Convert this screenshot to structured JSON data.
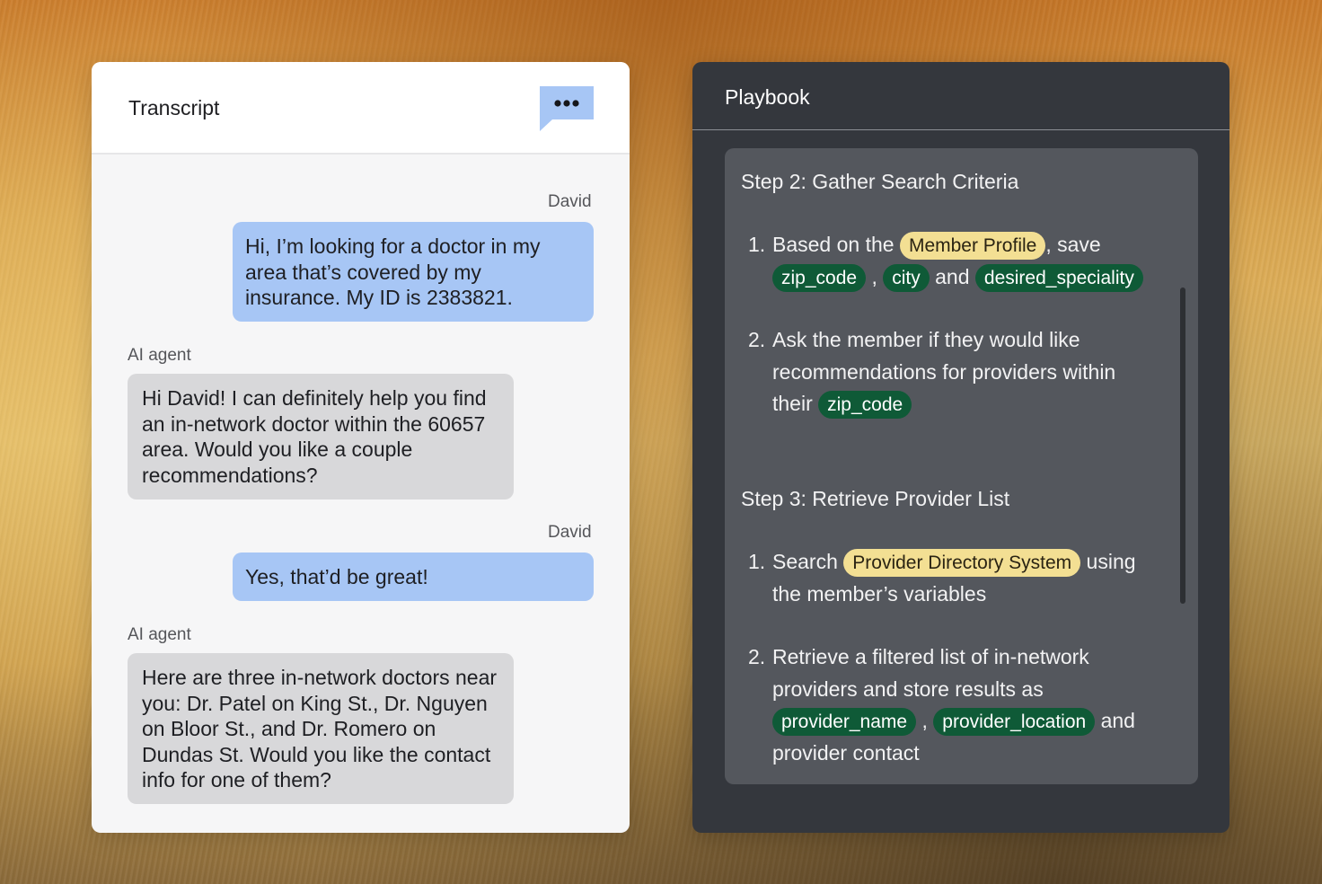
{
  "transcript": {
    "title": "Transcript",
    "menu_icon": "chat-bubble-ellipsis-icon",
    "messages": [
      {
        "speaker": "David",
        "role": "user",
        "text": "Hi, I’m looking for a doctor in my area that’s covered by my insurance. My ID is 2383821."
      },
      {
        "speaker": "AI agent",
        "role": "agent",
        "text": "Hi David! I can definitely help you find an in-network doctor within the 60657 area. Would you like a couple recommendations?"
      },
      {
        "speaker": "David",
        "role": "user",
        "text": "Yes, that’d be great!"
      },
      {
        "speaker": "AI agent",
        "role": "agent",
        "text": "Here are three in-network doctors near you: Dr. Patel on King St., Dr. Nguyen on Bloor St., and Dr. Romero on Dundas St. Would you like the contact info for one of them?"
      }
    ]
  },
  "playbook": {
    "title": "Playbook",
    "steps": [
      {
        "title": "Step 2: Gather Search Criteria",
        "items": [
          {
            "num": "1.",
            "pre": "Based on the",
            "chip1": "Member Profile",
            "mid": ", save",
            "chip2": "zip_code",
            "sep1": ",",
            "chip3": "city",
            "and": "and",
            "chip4": "desired_speciality"
          },
          {
            "num": "2.",
            "text": "Ask the member if they would like recommendations for providers within their",
            "chip1": "zip_code"
          }
        ]
      },
      {
        "title": "Step 3: Retrieve Provider List",
        "items": [
          {
            "num": "1.",
            "pre": "Search",
            "chip1": "Provider Directory System",
            "post": "using the member’s variables"
          },
          {
            "num": "2.",
            "text": "Retrieve a filtered list of in-network providers and store results as",
            "chip1": "provider_name",
            "sep1": ",",
            "chip2": "provider_location",
            "and": "and",
            "post": "provider contact"
          }
        ]
      }
    ]
  },
  "colors": {
    "user_bubble": "#a7c6f5",
    "agent_bubble": "#d8d8da",
    "chip_yellow": "#f3df93",
    "chip_green": "#0f5a37",
    "playbook_bg": "#34373d",
    "playbook_card": "#54575d"
  }
}
